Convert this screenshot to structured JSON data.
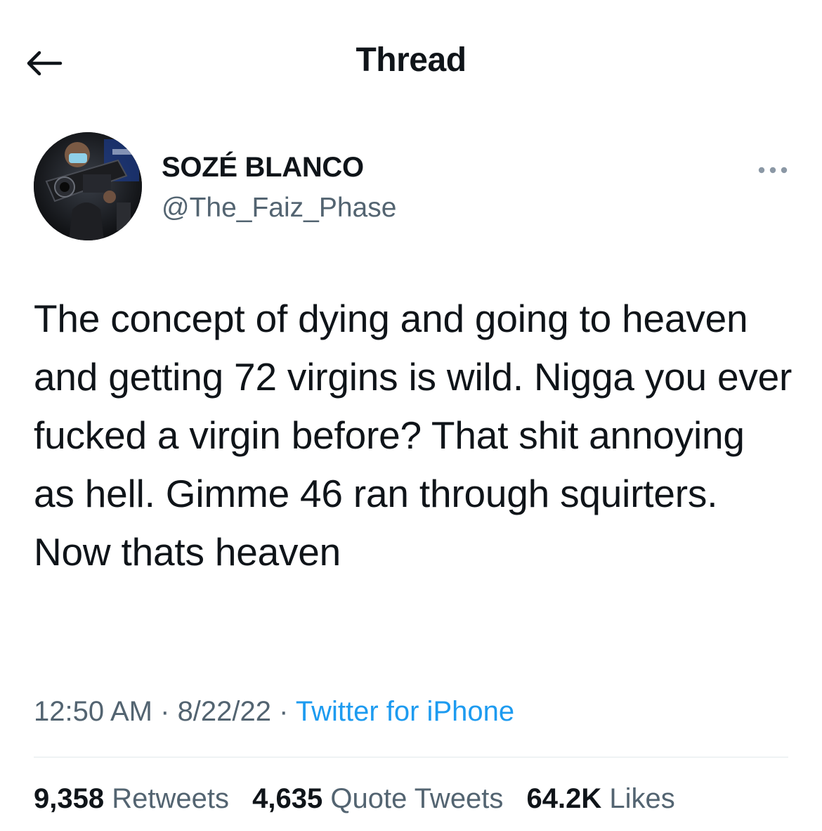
{
  "header": {
    "title": "Thread",
    "back_icon": "back-arrow-icon"
  },
  "author": {
    "display_name": "SOZÉ BLANCO",
    "handle": "@The_Faiz_Phase",
    "more_icon": "more-options-icon"
  },
  "tweet": {
    "text": "The concept of dying and going to heaven and getting 72 virgins is wild. Nigga you ever fucked a virgin before? That shit annoying as hell. Gimme 46 ran through squirters. Now thats heaven",
    "time": "12:50 AM",
    "separator": " · ",
    "date": "8/22/22",
    "source": "Twitter for iPhone"
  },
  "stats": {
    "retweets_count": "9,358",
    "retweets_label": "Retweets",
    "quotes_count": "4,635",
    "quotes_label": "Quote Tweets",
    "likes_count": "64.2K",
    "likes_label": "Likes"
  },
  "colors": {
    "text_primary": "#0f1419",
    "text_secondary": "#536471",
    "link": "#1d9bf0",
    "divider": "#eff3f4"
  }
}
